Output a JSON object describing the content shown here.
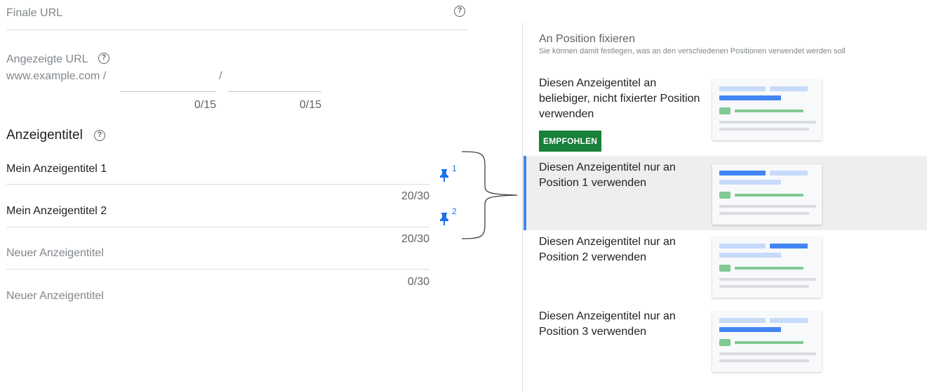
{
  "final_url": {
    "label": "Finale URL"
  },
  "display_url": {
    "label": "Angezeigte URL",
    "domain": "www.example.com /",
    "separator": "/",
    "path1_counter": "0/15",
    "path2_counter": "0/15"
  },
  "headlines": {
    "section_title": "Anzeigentitel",
    "items": [
      {
        "value": "Mein Anzeigentitel 1",
        "counter": "20/30",
        "pin_position": "1"
      },
      {
        "value": "Mein Anzeigentitel 2",
        "counter": "20/30",
        "pin_position": "2"
      },
      {
        "placeholder": "Neuer Anzeigentitel",
        "counter": "0/30"
      },
      {
        "placeholder": "Neuer Anzeigentitel"
      }
    ]
  },
  "pin_panel": {
    "title": "An Position fixieren",
    "subtitle": "Sie können damit festlegen, was an den verschiedenen Positionen verwendet werden soll",
    "options": [
      {
        "label": "Diesen Anzeigentitel an beliebiger, nicht fixierter Position verwenden",
        "badge": "EMPFOHLEN",
        "selected": false
      },
      {
        "label": "Diesen Anzeigentitel nur an Position 1 verwenden",
        "selected": true
      },
      {
        "label": "Diesen Anzeigentitel nur an Position 2 verwenden",
        "selected": false
      },
      {
        "label": "Diesen Anzeigentitel nur an Position 3 verwenden",
        "selected": false
      }
    ]
  },
  "colors": {
    "accent": "#1a73e8",
    "badge_green": "#188038",
    "preview_highlight": "#4285f4",
    "preview_light": "#c6dafc",
    "preview_green": "#81c995",
    "preview_gray": "#dadce0"
  },
  "icons": [
    "help-icon",
    "pin-icon",
    "bracket-connector"
  ]
}
